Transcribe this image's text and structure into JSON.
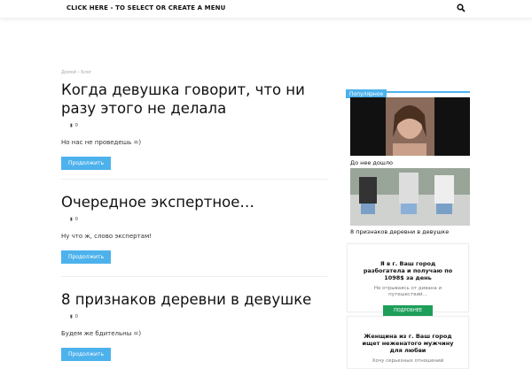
{
  "header": {
    "menu_label": "CLICK HERE - TO SELECT OR CREATE A MENU"
  },
  "breadcrumb": {
    "home": "Домой",
    "sep": "›",
    "current": "Блог"
  },
  "posts": [
    {
      "title": "Когда девушка говорит, что ни разу этого не делала",
      "comments": "0",
      "excerpt": "Но нас не проведешь =)",
      "button": "Продолжить"
    },
    {
      "title": "Очередное экспертное…",
      "comments": "0",
      "excerpt": "Ну что ж, слово экспертам!",
      "button": "Продолжить"
    },
    {
      "title": "8 признаков деревни в девушке",
      "comments": "0",
      "excerpt": "Будем же бдительны =)",
      "button": "Продолжить"
    }
  ],
  "sidebar": {
    "heading": "Популярное",
    "items": [
      {
        "caption": "До нее дошло"
      },
      {
        "caption": "8 признаков деревни в девушке"
      }
    ],
    "ads": [
      {
        "title": "Я в г. Ваш город разбогатела и получаю по 1098$ за день",
        "text": "Не отрываясь от дивана и путешествий...",
        "button": "ПОДРОБНЕЕ"
      },
      {
        "title": "Женщина из г. Ваш город ищет неженатого мужчину для любви",
        "text": "Хочу серьезных отношений"
      }
    ]
  },
  "colors": {
    "accent": "#4db2ec",
    "ad_button": "#1e9e5a"
  }
}
